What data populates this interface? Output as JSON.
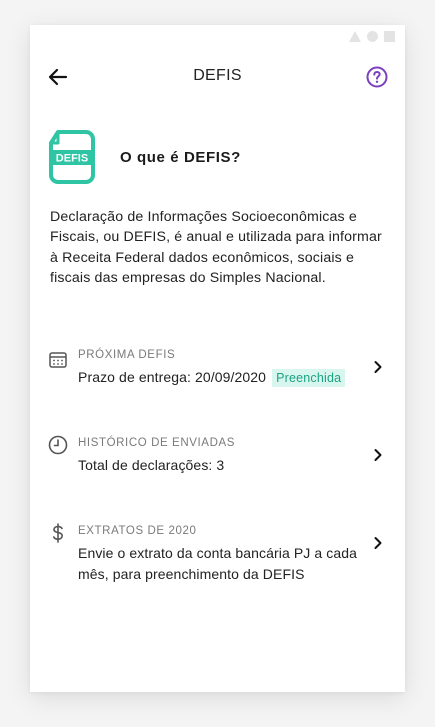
{
  "header": {
    "title": "DEFIS",
    "back_icon": "arrow-left-icon",
    "help_icon": "question-circle-icon"
  },
  "intro": {
    "logo_text": "DEFIS",
    "title": "O que é DEFIS?"
  },
  "description": "Declaração de Informações Socioeconômicas e Fiscais, ou DEFIS, é anual e utilizada para informar à Receita Federal dados econômicos, sociais e fiscais das empresas do Simples Nacional.",
  "items": [
    {
      "icon": "calendar-icon",
      "label": "PRÓXIMA DEFIS",
      "value": "Prazo de entrega: 20/09/2020",
      "badge": "Preenchida"
    },
    {
      "icon": "clock-icon",
      "label": "HISTÓRICO DE ENVIADAS",
      "value": "Total de declarações: 3"
    },
    {
      "icon": "dollar-icon",
      "label": "EXTRATOS DE 2020",
      "value": "Envie o extrato da conta bancária PJ a cada mês, para preenchimento da DEFIS"
    }
  ],
  "colors": {
    "accent_purple": "#7b3fbf",
    "logo_teal": "#2ec4a4",
    "badge_bg": "#d9f6ee",
    "badge_text": "#1aa385"
  }
}
